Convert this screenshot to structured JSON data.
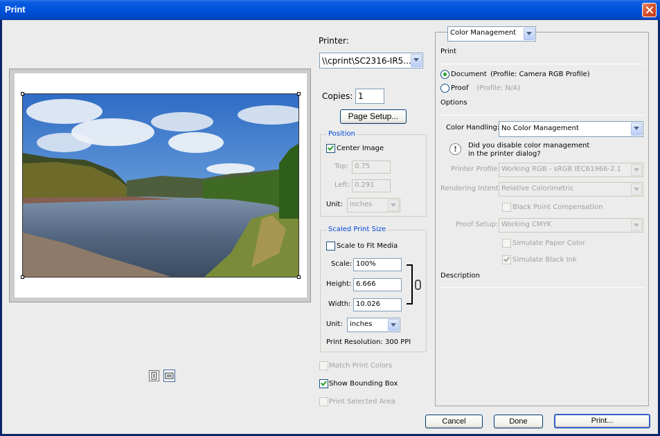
{
  "window": {
    "title": "Print"
  },
  "left": {
    "printer_label": "Printer:",
    "printer_value": "\\\\cprint\\SC2316-IR5...",
    "copies_label": "Copies:",
    "copies_value": "1",
    "page_setup_label": "Page Setup...",
    "position": {
      "title": "Position",
      "center_image_label": "Center Image",
      "center_image_checked": true,
      "top_label": "Top:",
      "top_value": "0.75",
      "left_label": "Left:",
      "left_value": "0.291",
      "unit_label": "Unit:",
      "unit_value": "inches"
    },
    "scaled": {
      "title": "Scaled Print Size",
      "scale_fit_label": "Scale to Fit Media",
      "scale_fit_checked": false,
      "scale_label": "Scale:",
      "scale_value": "100%",
      "height_label": "Height:",
      "height_value": "6.666",
      "width_label": "Width:",
      "width_value": "10.026",
      "unit_label": "Unit:",
      "unit_value": "inches",
      "resolution": "Print Resolution: 300 PPI"
    },
    "match_print_colors": "Match Print Colors",
    "show_bounding_box": "Show Bounding Box",
    "show_bounding_box_checked": true,
    "print_selected_area": "Print Selected Area"
  },
  "right": {
    "mode_value": "Color Management",
    "print_heading": "Print",
    "document_label": "Document",
    "document_profile": "(Profile: Camera RGB Profile)",
    "proof_label": "Proof",
    "proof_profile": "(Profile: N/A)",
    "options_heading": "Options",
    "color_handling_label": "Color Handling:",
    "color_handling_value": "No Color Management",
    "warning_line1": "Did you disable color management",
    "warning_line2": "in the printer dialog?",
    "printer_profile_label": "Printer Profile:",
    "printer_profile_value": "Working RGB - sRGB IEC61966-2.1",
    "rendering_intent_label": "Rendering Intent:",
    "rendering_intent_value": "Relative Colorimetric",
    "black_point_label": "Black Point Compensation",
    "proof_setup_label": "Proof Setup:",
    "proof_setup_value": "Working CMYK",
    "simulate_paper_label": "Simulate Paper Color",
    "simulate_ink_label": "Simulate Black Ink",
    "description_heading": "Description"
  },
  "buttons": {
    "cancel": "Cancel",
    "done": "Done",
    "print": "Print..."
  },
  "icons": {
    "close": "close-icon",
    "chain": "chain-link-icon",
    "info": "info-icon",
    "portrait": "portrait-orientation-icon",
    "landscape": "landscape-orientation-icon"
  }
}
